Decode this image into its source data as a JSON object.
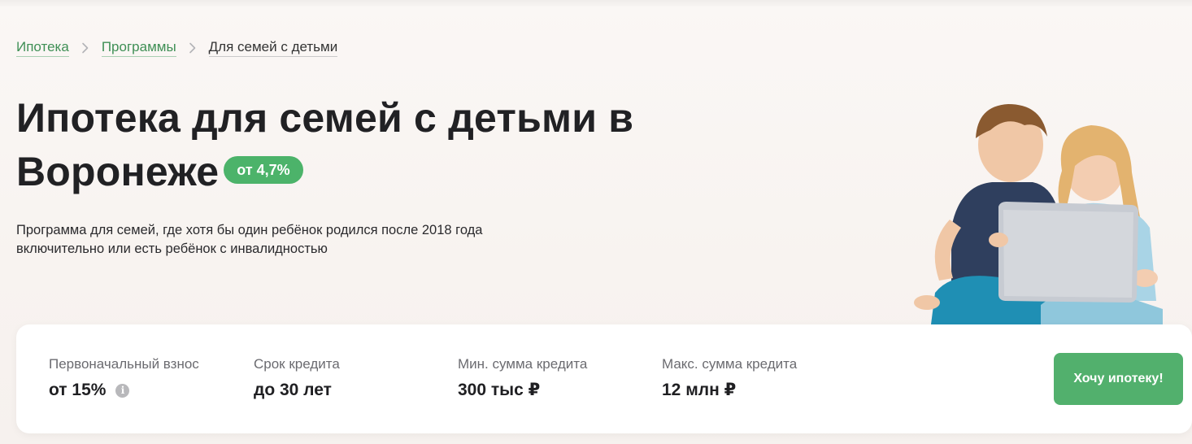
{
  "breadcrumbs": {
    "items": [
      {
        "label": "Ипотека"
      },
      {
        "label": "Программы"
      }
    ],
    "current": "Для семей с детьми"
  },
  "hero": {
    "title": "Ипотека для семей с детьми в Воронеже",
    "rate_badge": "от 4,7%",
    "description_line1": "Программа для семей, где хотя бы один ребёнок родился после 2018 года",
    "description_line2": "включительно или есть ребёнок с инвалидностью"
  },
  "params": [
    {
      "label": "Первоначальный взнос",
      "value": "от 15%"
    },
    {
      "label": "Срок кредита",
      "value": "до 30 лет"
    },
    {
      "label": "Мин. сумма кредита",
      "value": "300 тыс ₽"
    },
    {
      "label": "Макс. сумма кредита",
      "value": "12 млн ₽"
    }
  ],
  "cta": {
    "label": "Хочу ипотеку!"
  },
  "icons": {
    "breadcrumb_separator": "chevron-right-icon",
    "info": "info-icon"
  },
  "colors": {
    "accent": "#52b06d",
    "link": "#3f8f55",
    "badge": "#4cb36a"
  }
}
